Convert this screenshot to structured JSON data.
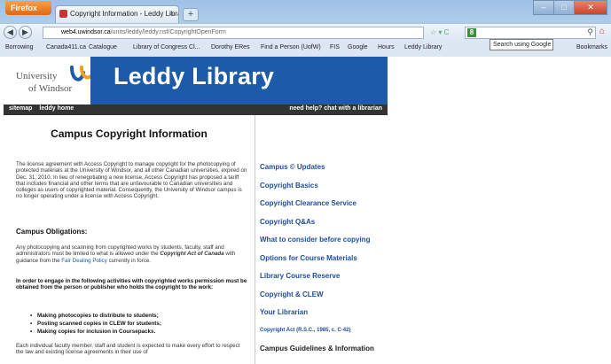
{
  "browser": {
    "app_button": "Firefox",
    "tab_title": "Copyright Information - Leddy Library, ...",
    "new_tab": "+",
    "url_host": "web4.uwindsor.ca",
    "url_path": "/units/leddy/leddy.nsf/CopyrightOpenForm",
    "url_prefix": "",
    "search_text": "",
    "tooltip": "Search using Google",
    "bookmarks": [
      "Borrowing",
      "Canada411.ca",
      "Catalogue",
      "Library of Congress Cl...",
      "Dorothy ERes",
      "Find a Person (UofW)",
      "FIS",
      "Google",
      "Hours",
      "Leddy Library"
    ],
    "bookmarks_right": "Bookmarks"
  },
  "site": {
    "university_line1": "University",
    "university_line2": "of Windsor",
    "library_name": "Leddy Library",
    "top_links": [
      "sitemap",
      "leddy home"
    ],
    "help_link": "need help? chat with a librarian"
  },
  "content": {
    "title": "Campus Copyright Information",
    "intro": "The license agreement with Access Copyright to manage copyright for the photocopying of protected materials at the University of Windsor, and all other Canadian universities, expired on Dec. 31, 2010. In lieu of renegotiating a new license, Access Copyright has proposed a tariff that includes financial and other terms that are unfavourable to Canadian universities and colleges as users of copyrighted material. Consequently, the University of Windsor campus is no longer operating under a license with Access Copyright.",
    "obligations_heading": "Campus Obligations:",
    "obligations_pre": "Any photocopying and scanning from copyrighted works by students, faculty, staff and administrators must be limited to what is allowed under the ",
    "obligations_act": "Copyright Act of Canada",
    "obligations_mid": " with guidance from the ",
    "obligations_link": "Fair Dealing Policy",
    "obligations_post": " currently in force.",
    "permission_text": "In order to engage in the following activities with copyrighted works permission must be obtained from the person or publisher who holds the copyright to the work:",
    "bullets": [
      "Making photocopies to distribute to students;",
      "Posting scanned copies in CLEW for students;",
      "Making copies for inclusion in Coursepacks."
    ],
    "closing": "Each individual faculty member, staff and student is expected to make every effort to respect the law and existing license agreements in their use of"
  },
  "sidebar_links": [
    "Campus © Updates",
    "Copyright Basics",
    "Copyright Clearance Service",
    "Copyright Q&As",
    "What to consider before copying",
    "Options for Course Materials",
    "Library Course Reserve",
    "Copyright & CLEW",
    "Your Librarian",
    "Copyright Act (R.S.C., 1985, c. C-42)",
    "Campus Guidelines & Information"
  ],
  "colors": {
    "banner": "#1d5aa8",
    "link": "#1d4e9a",
    "nav_bar": "#333333"
  }
}
